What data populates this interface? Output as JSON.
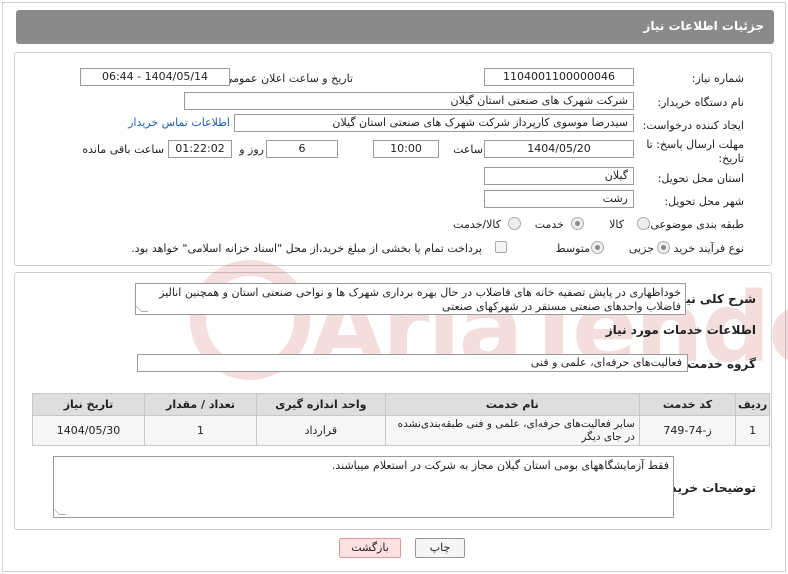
{
  "header": {
    "title": "جزئیات اطلاعات نیاز"
  },
  "form": {
    "need_number_label": "شماره نیاز:",
    "need_number": "1104001100000046",
    "announce_label": "تاریخ و ساعت اعلان عمومی:",
    "announce_value": "1404/05/14 - 06:44",
    "buyer_org_label": "نام دستگاه خریدار:",
    "buyer_org": "شرکت شهرک های صنعتی استان گیلان",
    "creator_label": "ایجاد کننده درخواست:",
    "creator": "سیدرضا موسوی کارپرداز  شرکت شهرک های صنعتی استان گیلان",
    "contact_link": "اطلاعات تماس خریدار",
    "deadline_label_1": "مهلت ارسال پاسخ: تا",
    "deadline_label_2": "تاریخ:",
    "deadline_date": "1404/05/20",
    "time_label": "ساعت",
    "deadline_time": "10:00",
    "days_value": "6",
    "days_label": "روز و",
    "remaining_value": "01:22:02",
    "remaining_label": "ساعت باقی مانده",
    "province_label": "استان محل تحویل:",
    "province": "گیلان",
    "city_label": "شهر محل تحویل:",
    "city": "رشت",
    "category_label": "طبقه بندی موضوعی:",
    "category_options": [
      "کالا",
      "خدمت",
      "کالا/خدمت"
    ],
    "category_selected": "خدمت",
    "process_label": "نوع فرآیند خرید :",
    "process_options": [
      "جزیی",
      "متوسط"
    ],
    "process_selected": "جزیی",
    "payment_note": "پرداخت تمام یا بخشی از مبلغ خرید،از محل \"اسناد خزانه اسلامی\" خواهد بود."
  },
  "description": {
    "label": "شرح کلی نیاز:",
    "text": "خوداظهاری در پایش تصفیه خانه های فاضلاب در حال بهره برداری شهرک ها و نواحی صنعتی استان  و همچنین انالیز فاضلاب واحدهای صنعتی مستقر در شهرکهای صنعتی"
  },
  "services": {
    "section_title": "اطلاعات خدمات مورد نیاز",
    "group_label": "گروه خدمت:",
    "group_value": "فعالیت‌های حرفه‌ای، علمی و فنی",
    "columns": [
      "ردیف",
      "کد خدمت",
      "نام خدمت",
      "واحد اندازه گیری",
      "تعداد / مقدار",
      "تاریخ نیاز"
    ],
    "rows": [
      {
        "row": "1",
        "code": "ز-74-749",
        "name": "سایر فعالیت‌های حرفه‌ای، علمی و فنی طبقه‌بندی‌نشده در جای دیگر",
        "unit": "قرارداد",
        "qty": "1",
        "date": "1404/05/30"
      }
    ]
  },
  "buyer_notes": {
    "label": "توضیحات خریدار:",
    "text": "فقط آزمایشگاههای بومی استان گیلان مجاز به شرکت در استعلام میباشند."
  },
  "buttons": {
    "print": "چاپ",
    "back": "بازگشت"
  },
  "watermark": {
    "text": "AriaTender.net"
  }
}
